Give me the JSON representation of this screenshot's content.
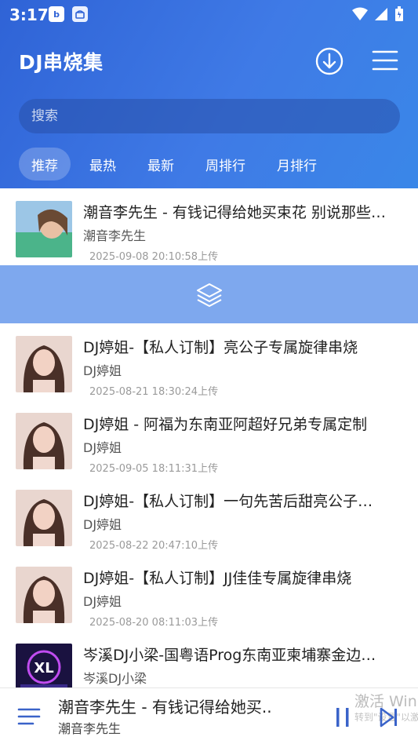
{
  "status_bar": {
    "time": "3:17",
    "app_badge_b": "b"
  },
  "header": {
    "title": "DJ串烧集",
    "download_icon": "download-circle-icon",
    "menu_icon": "hamburger-menu-icon"
  },
  "search": {
    "placeholder": "搜索"
  },
  "tabs": [
    {
      "label": "推荐",
      "active": true
    },
    {
      "label": "最热",
      "active": false
    },
    {
      "label": "最新",
      "active": false
    },
    {
      "label": "周排行",
      "active": false
    },
    {
      "label": "月排行",
      "active": false
    }
  ],
  "tracks": [
    {
      "title": "潮音李先生 - 有钱记得给她买束花  别说那些…",
      "artist": "潮音李先生",
      "date": "2025-09-08 20:10:58上传"
    },
    {
      "title": "DJ婷姐-【私人订制】亮公子专属旋律串烧",
      "artist": "DJ婷姐",
      "date": "2025-08-21 18:30:24上传"
    },
    {
      "title": "DJ婷姐 - 阿福为东南亚阿超好兄弟专属定制",
      "artist": "DJ婷姐",
      "date": "2025-09-05 18:11:31上传"
    },
    {
      "title": "DJ婷姐-【私人订制】一句先苦后甜亮公子…",
      "artist": "DJ婷姐",
      "date": "2025-08-22 20:47:10上传"
    },
    {
      "title": "DJ婷姐-【私人订制】JJ佳佳专属旋律串烧",
      "artist": "DJ婷姐",
      "date": "2025-08-20 08:11:03上传"
    },
    {
      "title": "岑溪DJ小梁-国粤语Prog东南亚柬埔寨金边…",
      "artist": "岑溪DJ小梁",
      "date": ""
    }
  ],
  "player": {
    "title": "潮音李先生 - 有钱记得给她买..",
    "artist": "潮音李先生"
  },
  "watermark": {
    "line1": "激活 Win",
    "line2": "转到\"设置\"以激活"
  },
  "colors": {
    "header_start": "#2f63d6",
    "header_end": "#3a87e8",
    "banner": "#7ea8ee",
    "accent": "#3a63c9"
  }
}
